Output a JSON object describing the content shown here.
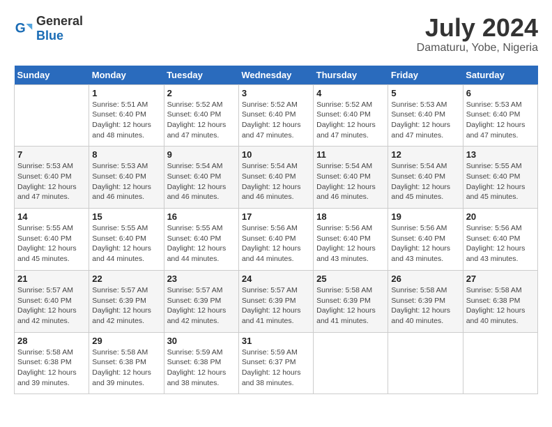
{
  "header": {
    "logo_general": "General",
    "logo_blue": "Blue",
    "month_year": "July 2024",
    "location": "Damaturu, Yobe, Nigeria"
  },
  "weekdays": [
    "Sunday",
    "Monday",
    "Tuesday",
    "Wednesday",
    "Thursday",
    "Friday",
    "Saturday"
  ],
  "weeks": [
    [
      {
        "day": "",
        "info": ""
      },
      {
        "day": "1",
        "info": "Sunrise: 5:51 AM\nSunset: 6:40 PM\nDaylight: 12 hours\nand 48 minutes."
      },
      {
        "day": "2",
        "info": "Sunrise: 5:52 AM\nSunset: 6:40 PM\nDaylight: 12 hours\nand 47 minutes."
      },
      {
        "day": "3",
        "info": "Sunrise: 5:52 AM\nSunset: 6:40 PM\nDaylight: 12 hours\nand 47 minutes."
      },
      {
        "day": "4",
        "info": "Sunrise: 5:52 AM\nSunset: 6:40 PM\nDaylight: 12 hours\nand 47 minutes."
      },
      {
        "day": "5",
        "info": "Sunrise: 5:53 AM\nSunset: 6:40 PM\nDaylight: 12 hours\nand 47 minutes."
      },
      {
        "day": "6",
        "info": "Sunrise: 5:53 AM\nSunset: 6:40 PM\nDaylight: 12 hours\nand 47 minutes."
      }
    ],
    [
      {
        "day": "7",
        "info": "Sunrise: 5:53 AM\nSunset: 6:40 PM\nDaylight: 12 hours\nand 47 minutes."
      },
      {
        "day": "8",
        "info": "Sunrise: 5:53 AM\nSunset: 6:40 PM\nDaylight: 12 hours\nand 46 minutes."
      },
      {
        "day": "9",
        "info": "Sunrise: 5:54 AM\nSunset: 6:40 PM\nDaylight: 12 hours\nand 46 minutes."
      },
      {
        "day": "10",
        "info": "Sunrise: 5:54 AM\nSunset: 6:40 PM\nDaylight: 12 hours\nand 46 minutes."
      },
      {
        "day": "11",
        "info": "Sunrise: 5:54 AM\nSunset: 6:40 PM\nDaylight: 12 hours\nand 46 minutes."
      },
      {
        "day": "12",
        "info": "Sunrise: 5:54 AM\nSunset: 6:40 PM\nDaylight: 12 hours\nand 45 minutes."
      },
      {
        "day": "13",
        "info": "Sunrise: 5:55 AM\nSunset: 6:40 PM\nDaylight: 12 hours\nand 45 minutes."
      }
    ],
    [
      {
        "day": "14",
        "info": "Sunrise: 5:55 AM\nSunset: 6:40 PM\nDaylight: 12 hours\nand 45 minutes."
      },
      {
        "day": "15",
        "info": "Sunrise: 5:55 AM\nSunset: 6:40 PM\nDaylight: 12 hours\nand 44 minutes."
      },
      {
        "day": "16",
        "info": "Sunrise: 5:55 AM\nSunset: 6:40 PM\nDaylight: 12 hours\nand 44 minutes."
      },
      {
        "day": "17",
        "info": "Sunrise: 5:56 AM\nSunset: 6:40 PM\nDaylight: 12 hours\nand 44 minutes."
      },
      {
        "day": "18",
        "info": "Sunrise: 5:56 AM\nSunset: 6:40 PM\nDaylight: 12 hours\nand 43 minutes."
      },
      {
        "day": "19",
        "info": "Sunrise: 5:56 AM\nSunset: 6:40 PM\nDaylight: 12 hours\nand 43 minutes."
      },
      {
        "day": "20",
        "info": "Sunrise: 5:56 AM\nSunset: 6:40 PM\nDaylight: 12 hours\nand 43 minutes."
      }
    ],
    [
      {
        "day": "21",
        "info": "Sunrise: 5:57 AM\nSunset: 6:40 PM\nDaylight: 12 hours\nand 42 minutes."
      },
      {
        "day": "22",
        "info": "Sunrise: 5:57 AM\nSunset: 6:39 PM\nDaylight: 12 hours\nand 42 minutes."
      },
      {
        "day": "23",
        "info": "Sunrise: 5:57 AM\nSunset: 6:39 PM\nDaylight: 12 hours\nand 42 minutes."
      },
      {
        "day": "24",
        "info": "Sunrise: 5:57 AM\nSunset: 6:39 PM\nDaylight: 12 hours\nand 41 minutes."
      },
      {
        "day": "25",
        "info": "Sunrise: 5:58 AM\nSunset: 6:39 PM\nDaylight: 12 hours\nand 41 minutes."
      },
      {
        "day": "26",
        "info": "Sunrise: 5:58 AM\nSunset: 6:39 PM\nDaylight: 12 hours\nand 40 minutes."
      },
      {
        "day": "27",
        "info": "Sunrise: 5:58 AM\nSunset: 6:38 PM\nDaylight: 12 hours\nand 40 minutes."
      }
    ],
    [
      {
        "day": "28",
        "info": "Sunrise: 5:58 AM\nSunset: 6:38 PM\nDaylight: 12 hours\nand 39 minutes."
      },
      {
        "day": "29",
        "info": "Sunrise: 5:58 AM\nSunset: 6:38 PM\nDaylight: 12 hours\nand 39 minutes."
      },
      {
        "day": "30",
        "info": "Sunrise: 5:59 AM\nSunset: 6:38 PM\nDaylight: 12 hours\nand 38 minutes."
      },
      {
        "day": "31",
        "info": "Sunrise: 5:59 AM\nSunset: 6:37 PM\nDaylight: 12 hours\nand 38 minutes."
      },
      {
        "day": "",
        "info": ""
      },
      {
        "day": "",
        "info": ""
      },
      {
        "day": "",
        "info": ""
      }
    ]
  ]
}
